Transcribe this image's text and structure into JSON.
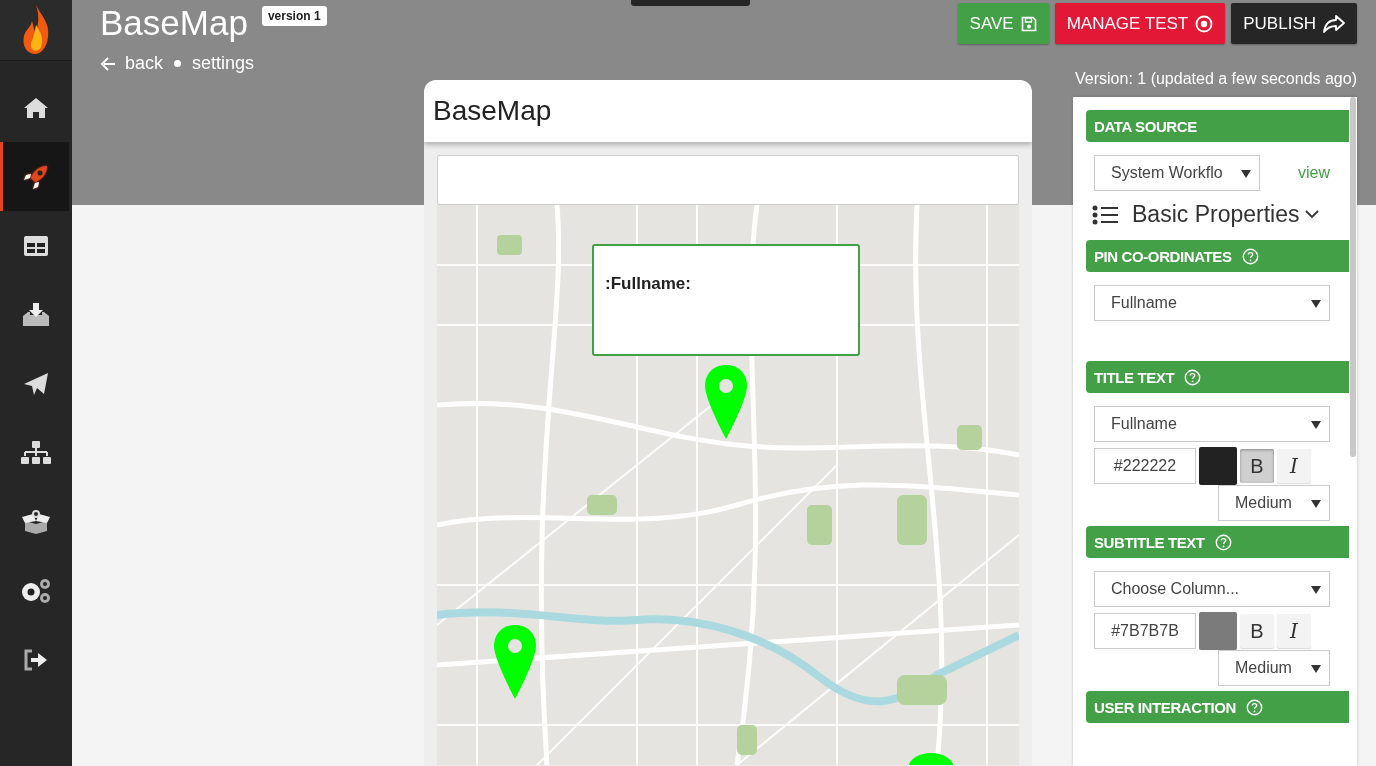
{
  "nav": [
    {
      "kind": "home",
      "selected": false
    },
    {
      "kind": "rocket",
      "selected": true
    },
    {
      "kind": "table",
      "selected": false
    },
    {
      "kind": "inbox",
      "selected": false
    },
    {
      "kind": "plane",
      "selected": false
    },
    {
      "kind": "sitemap",
      "selected": false
    },
    {
      "kind": "box",
      "selected": false
    },
    {
      "kind": "gears",
      "selected": false
    },
    {
      "kind": "signout",
      "selected": false
    }
  ],
  "header": {
    "title": "BaseMap",
    "badge": "version 1",
    "links": [
      "back",
      "settings"
    ],
    "buttons": [
      {
        "kind": "save",
        "label": "SAVE"
      },
      {
        "kind": "test",
        "label": "MANAGE TEST"
      },
      {
        "kind": "publish",
        "label": "PUBLISH"
      }
    ],
    "version_note": "Version: 1 (updated a few seconds ago)"
  },
  "preview": {
    "title": "BaseMap",
    "popup_title": ":Fullname:"
  },
  "panel": {
    "data_source": {
      "heading": "DATA SOURCE",
      "value": "System Workflo",
      "link": "view"
    },
    "group_label": "Basic Properties",
    "sections": [
      {
        "kind": "select",
        "heading": "PIN CO-ORDINATES",
        "value": "Fullname"
      },
      {
        "kind": "text_style",
        "heading": "TITLE TEXT",
        "value": "Fullname",
        "color_value": "#222222",
        "bold_label": "B",
        "bold": true,
        "italic_label": "I",
        "italic": false,
        "size": "Medium"
      },
      {
        "kind": "text_style",
        "heading": "SUBTITLE TEXT",
        "value": "Choose Column...",
        "color_value": "#7B7B7B",
        "bold_label": "B",
        "bold": false,
        "italic_label": "I",
        "italic": false,
        "size": "Medium"
      },
      {
        "kind": "heading",
        "heading": "USER INTERACTION"
      }
    ]
  }
}
